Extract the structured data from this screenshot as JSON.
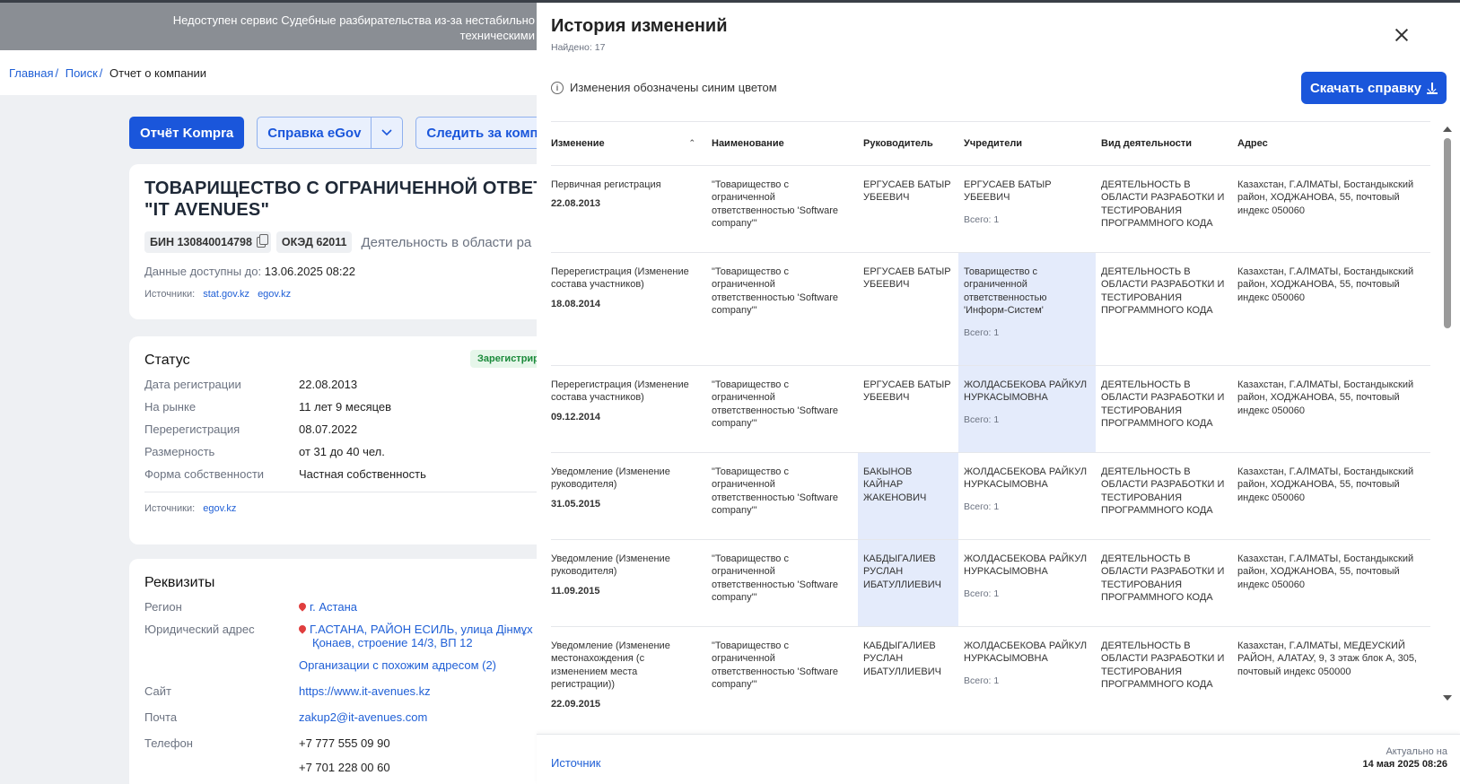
{
  "banner": {
    "line1": "Недоступен сервис Судебные разбирательства из-за нестабильно",
    "line2": "техническими"
  },
  "breadcrumb": {
    "home": "Главная",
    "search": "Поиск",
    "current": "Отчет о компании"
  },
  "actions": {
    "kompra_report": "Отчёт Kompra",
    "egov_reference": "Справка eGov",
    "follow": "Следить за компани"
  },
  "company": {
    "name_line1": "ТОВАРИЩЕСТВО С ОГРАНИЧЕННОЙ ОТВЕТ",
    "name_line2": "\"IT AVENUES\"",
    "bin": "БИН 130840014798",
    "okved": "ОКЭД 62011",
    "activity": "Деятельность в области ра",
    "available_label": "Данные доступны до:",
    "available_value": "13.06.2025 08:22",
    "sources_label": "Источники:",
    "sources": [
      "stat.gov.kz",
      "egov.kz"
    ]
  },
  "status": {
    "title": "Статус",
    "badge": "Зарегистрир",
    "rows": [
      {
        "k": "Дата регистрации",
        "v": "22.08.2013"
      },
      {
        "k": "На рынке",
        "v": "11 лет 9 месяцев"
      },
      {
        "k": "Перерегистрация",
        "v": "08.07.2022"
      },
      {
        "k": "Размерность",
        "v": "от 31 до 40 чел."
      },
      {
        "k": "Форма собственности",
        "v": "Частная собственность"
      }
    ],
    "sources_label": "Источники:",
    "source": "egov.kz"
  },
  "requisites": {
    "title": "Реквизиты",
    "region_label": "Регион",
    "region": "г. Астана",
    "address_label": "Юридический адрес",
    "address_line1": "Г.АСТАНА, РАЙОН ЕСИЛЬ, улица Дінмұх",
    "address_line2": "Қонаев, строение 14/3, ВП 12",
    "similar": "Организации с похожим адресом (2)",
    "site_label": "Сайт",
    "site": "https://www.it-avenues.kz",
    "mail_label": "Почта",
    "mail": "zakup2@it-avenues.com",
    "phone_label": "Телефон",
    "phone1": "+7 777 555 09 90",
    "phone2": "+7 701 228 00 60"
  },
  "panel": {
    "title": "История изменений",
    "found": "Найдено: 17",
    "info": "Изменения обозначены синим цветом",
    "download": "Скачать справку",
    "columns": [
      "Изменение",
      "Наименование",
      "Руководитель",
      "Учредители",
      "Вид деятельности",
      "Адрес"
    ],
    "rows": [
      {
        "change": "Первичная регистрация",
        "date": "22.08.2013",
        "name": "\"Товарищество с ограниченной ответственностью 'Software company'\"",
        "head": "ЕРГУСАЕВ БАТЫР УБЕЕВИЧ",
        "founders": "ЕРГУСАЕВ БАТЫР УБЕЕВИЧ",
        "total": "Всего: 1",
        "activity": "ДЕЯТЕЛЬНОСТЬ В ОБЛАСТИ РАЗРАБОТКИ И ТЕСТИРОВАНИЯ ПРОГРАММНОГО КОДА",
        "address": "Казахстан, Г.АЛМАТЫ, Бостандыкский район, ХОДЖАНОВА, 55, почтовый индекс 050060",
        "hl_head": false,
        "hl_founders": false
      },
      {
        "change": "Перерегистрация (Изменение состава участников)",
        "date": "18.08.2014",
        "name": "\"Товарищество с ограниченной ответственностью 'Software company'\"",
        "head": "ЕРГУСАЕВ БАТЫР УБЕЕВИЧ",
        "founders": "Товарищество с ограниченной ответственностью 'Информ-Систем'",
        "total": "Всего: 1",
        "activity": "ДЕЯТЕЛЬНОСТЬ В ОБЛАСТИ РАЗРАБОТКИ И ТЕСТИРОВАНИЯ ПРОГРАММНОГО КОДА",
        "address": "Казахстан, Г.АЛМАТЫ, Бостандыкский район, ХОДЖАНОВА, 55, почтовый индекс 050060",
        "hl_head": false,
        "hl_founders": true
      },
      {
        "change": "Перерегистрация (Изменение состава участников)",
        "date": "09.12.2014",
        "name": "\"Товарищество с ограниченной ответственностью 'Software company'\"",
        "head": "ЕРГУСАЕВ БАТЫР УБЕЕВИЧ",
        "founders": "ЖОЛДАСБЕКОВА РАЙКУЛ НУРКАСЫМОВНА",
        "total": "Всего: 1",
        "activity": "ДЕЯТЕЛЬНОСТЬ В ОБЛАСТИ РАЗРАБОТКИ И ТЕСТИРОВАНИЯ ПРОГРАММНОГО КОДА",
        "address": "Казахстан, Г.АЛМАТЫ, Бостандыкский район, ХОДЖАНОВА, 55, почтовый индекс 050060",
        "hl_head": false,
        "hl_founders": true
      },
      {
        "change": "Уведомление (Изменение руководителя)",
        "date": "31.05.2015",
        "name": "\"Товарищество с ограниченной ответственностью 'Software company'\"",
        "head": "БАКЫНОВ КАЙНАР ЖАКЕНОВИЧ",
        "founders": "ЖОЛДАСБЕКОВА РАЙКУЛ НУРКАСЫМОВНА",
        "total": "Всего: 1",
        "activity": "ДЕЯТЕЛЬНОСТЬ В ОБЛАСТИ РАЗРАБОТКИ И ТЕСТИРОВАНИЯ ПРОГРАММНОГО КОДА",
        "address": "Казахстан, Г.АЛМАТЫ, Бостандыкский район, ХОДЖАНОВА, 55, почтовый индекс 050060",
        "hl_head": true,
        "hl_founders": false
      },
      {
        "change": "Уведомление (Изменение руководителя)",
        "date": "11.09.2015",
        "name": "\"Товарищество с ограниченной ответственностью 'Software company'\"",
        "head": "КАБДЫГАЛИЕВ РУСЛАН ИБАТУЛЛИЕВИЧ",
        "founders": "ЖОЛДАСБЕКОВА РАЙКУЛ НУРКАСЫМОВНА",
        "total": "Всего: 1",
        "activity": "ДЕЯТЕЛЬНОСТЬ В ОБЛАСТИ РАЗРАБОТКИ И ТЕСТИРОВАНИЯ ПРОГРАММНОГО КОДА",
        "address": "Казахстан, Г.АЛМАТЫ, Бостандыкский район, ХОДЖАНОВА, 55, почтовый индекс 050060",
        "hl_head": true,
        "hl_founders": false
      },
      {
        "change": "Уведомление (Изменение местонахождения (с изменением места регистрации))",
        "date": "22.09.2015",
        "name": "\"Товарищество с ограниченной ответственностью 'Software company'\"",
        "head": "КАБДЫГАЛИЕВ РУСЛАН ИБАТУЛЛИЕВИЧ",
        "founders": "ЖОЛДАСБЕКОВА РАЙКУЛ НУРКАСЫМОВНА",
        "total": "Всего: 1",
        "activity": "ДЕЯТЕЛЬНОСТЬ В ОБЛАСТИ РАЗРАБОТКИ И ТЕСТИРОВАНИЯ ПРОГРАММНОГО КОДА",
        "address": "Казахстан, Г.АЛМАТЫ, МЕДЕУСКИЙ РАЙОН, АЛАТАУ, 9, 3 этаж блок А, 305, почтовый индекс 050000",
        "hl_head": false,
        "hl_founders": false
      }
    ],
    "footer_source": "Источник",
    "actual_label": "Актуально на",
    "actual_value": "14 мая 2025 08:26"
  },
  "colors": {
    "accent": "#1a56db",
    "highlight": "#e4ebfb",
    "badge_green": "#1a8a3a"
  }
}
